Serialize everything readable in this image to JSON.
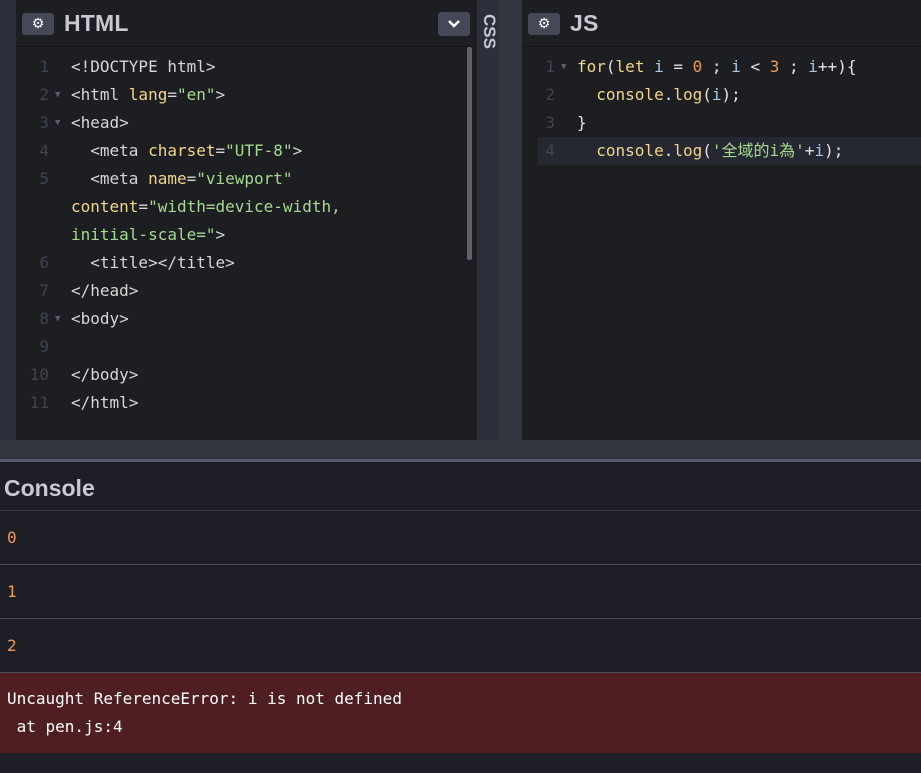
{
  "html_panel": {
    "title": "HTML",
    "lines": [
      {
        "n": "1",
        "fold": "",
        "parts": [
          [
            "t-tag",
            "<!DOCTYPE html>"
          ]
        ]
      },
      {
        "n": "2",
        "fold": "▼",
        "parts": [
          [
            "t-tag",
            "<html "
          ],
          [
            "t-attr",
            "lang"
          ],
          [
            "t-tag",
            "="
          ],
          [
            "t-str",
            "\"en\""
          ],
          [
            "t-tag",
            ">"
          ]
        ]
      },
      {
        "n": "3",
        "fold": "▼",
        "parts": [
          [
            "t-tag",
            "<head>"
          ]
        ]
      },
      {
        "n": "4",
        "fold": "",
        "parts": [
          [
            "t-tag",
            "  <meta "
          ],
          [
            "t-attr",
            "charset"
          ],
          [
            "t-tag",
            "="
          ],
          [
            "t-str",
            "\"UTF-8\""
          ],
          [
            "t-tag",
            ">"
          ]
        ]
      },
      {
        "n": "5",
        "fold": "",
        "parts": [
          [
            "t-tag",
            "  <meta "
          ],
          [
            "t-attr",
            "name"
          ],
          [
            "t-tag",
            "="
          ],
          [
            "t-str",
            "\"viewport\""
          ]
        ],
        "wrap": [
          [
            [
              "t-attr",
              "content"
            ],
            [
              "t-tag",
              "="
            ],
            [
              "t-str",
              "\"width=device-width,"
            ]
          ],
          [
            [
              "t-str",
              "initial-scale=\""
            ],
            [
              "t-tag",
              ">"
            ]
          ]
        ]
      },
      {
        "n": "6",
        "fold": "",
        "parts": [
          [
            "t-tag",
            "  <title></title>"
          ]
        ]
      },
      {
        "n": "7",
        "fold": "",
        "parts": [
          [
            "t-tag",
            "</head>"
          ]
        ]
      },
      {
        "n": "8",
        "fold": "▼",
        "parts": [
          [
            "t-tag",
            "<body>"
          ]
        ]
      },
      {
        "n": "9",
        "fold": "",
        "parts": []
      },
      {
        "n": "10",
        "fold": "",
        "parts": [
          [
            "t-tag",
            "</body>"
          ]
        ]
      },
      {
        "n": "11",
        "fold": "",
        "parts": [
          [
            "t-tag",
            "</html>"
          ]
        ]
      }
    ]
  },
  "css_panel": {
    "title": "CSS"
  },
  "js_panel": {
    "title": "JS",
    "lines": [
      {
        "n": "1",
        "fold": "▼",
        "parts": [
          [
            "t-kw",
            "for"
          ],
          [
            "t-def",
            "("
          ],
          [
            "t-kw",
            "let"
          ],
          [
            "t-def",
            " "
          ],
          [
            "t-var",
            "i"
          ],
          [
            "t-def",
            " = "
          ],
          [
            "t-num",
            "0"
          ],
          [
            "t-def",
            " ; "
          ],
          [
            "t-var",
            "i"
          ],
          [
            "t-def",
            " < "
          ],
          [
            "t-num",
            "3"
          ],
          [
            "t-def",
            " ; "
          ],
          [
            "t-var",
            "i"
          ],
          [
            "t-def",
            "++){"
          ]
        ]
      },
      {
        "n": "2",
        "fold": "",
        "parts": [
          [
            "t-def",
            "  "
          ],
          [
            "t-kw",
            "console"
          ],
          [
            "t-def",
            "."
          ],
          [
            "t-attr",
            "log"
          ],
          [
            "t-def",
            "("
          ],
          [
            "t-var",
            "i"
          ],
          [
            "t-def",
            ");"
          ]
        ]
      },
      {
        "n": "3",
        "fold": "",
        "parts": [
          [
            "t-def",
            "}"
          ]
        ]
      },
      {
        "n": "4",
        "fold": "",
        "parts": [
          [
            "t-def",
            "  "
          ],
          [
            "t-kw",
            "console"
          ],
          [
            "t-def",
            "."
          ],
          [
            "t-attr",
            "log"
          ],
          [
            "t-def",
            "("
          ],
          [
            "t-str",
            "'全域的i為'"
          ],
          [
            "t-def",
            "+"
          ],
          [
            "t-var",
            "i"
          ],
          [
            "t-def",
            ");"
          ]
        ]
      }
    ]
  },
  "console": {
    "title": "Console",
    "logs": [
      "0",
      "1",
      "2"
    ],
    "error": {
      "line1": "Uncaught ReferenceError: i is not defined",
      "line2": " at pen.js:4"
    }
  },
  "icons": {
    "settings": "gear-icon",
    "collapse": "chevron-down-icon"
  }
}
